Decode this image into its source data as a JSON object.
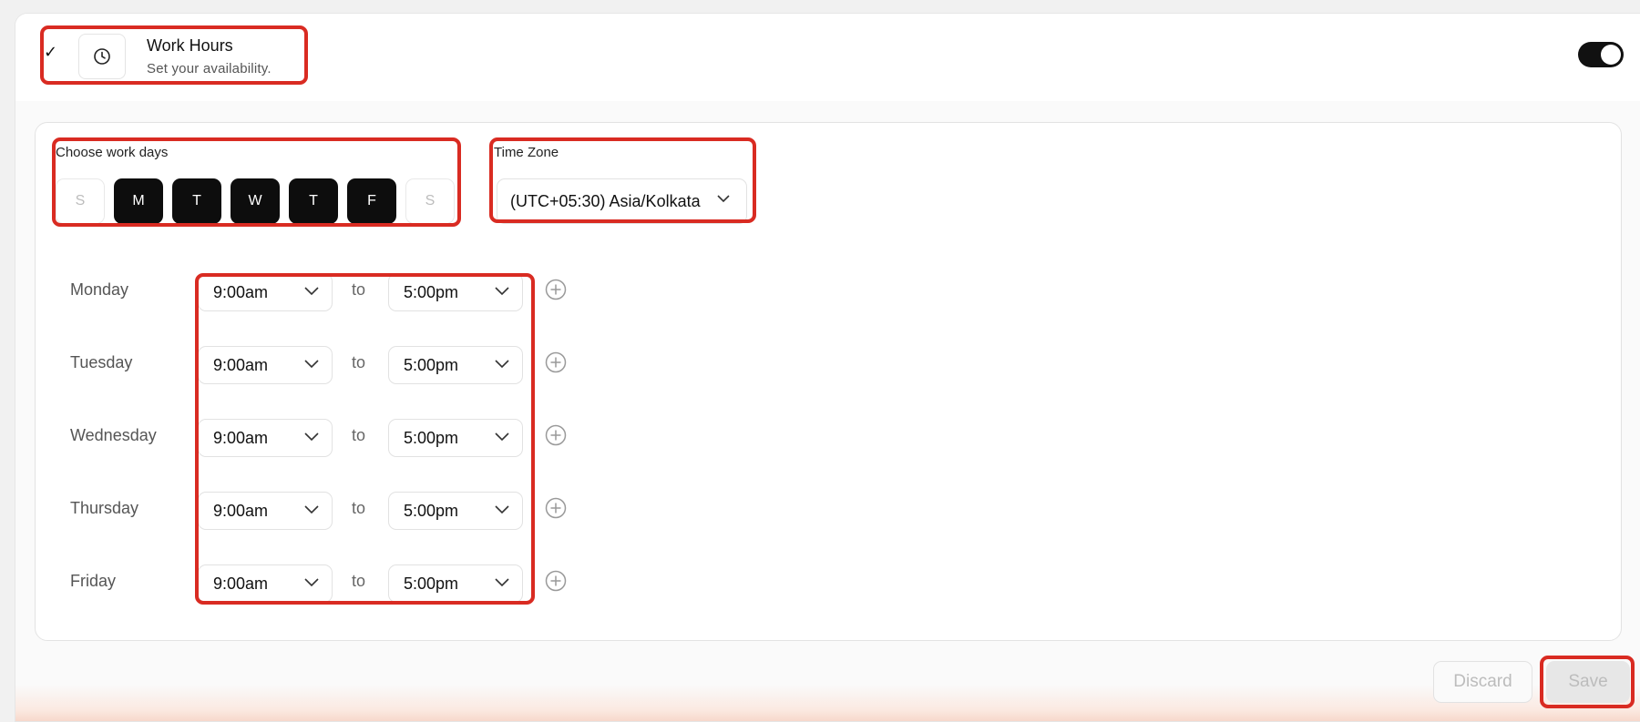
{
  "header": {
    "check_glyph": "✓",
    "title": "Work Hours",
    "subtitle": "Set your availability.",
    "enabled": true,
    "icon": "clock-icon"
  },
  "workdays": {
    "label": "Choose work days",
    "days": [
      {
        "letter": "S",
        "selected": false
      },
      {
        "letter": "M",
        "selected": true
      },
      {
        "letter": "T",
        "selected": true
      },
      {
        "letter": "W",
        "selected": true
      },
      {
        "letter": "T",
        "selected": true
      },
      {
        "letter": "F",
        "selected": true
      },
      {
        "letter": "S",
        "selected": false
      }
    ]
  },
  "timezone": {
    "label": "Time Zone",
    "value": "(UTC+05:30) Asia/Kolkata"
  },
  "schedule": {
    "to_label": "to",
    "rows": [
      {
        "day": "Monday",
        "start": "9:00am",
        "end": "5:00pm"
      },
      {
        "day": "Tuesday",
        "start": "9:00am",
        "end": "5:00pm"
      },
      {
        "day": "Wednesday",
        "start": "9:00am",
        "end": "5:00pm"
      },
      {
        "day": "Thursday",
        "start": "9:00am",
        "end": "5:00pm"
      },
      {
        "day": "Friday",
        "start": "9:00am",
        "end": "5:00pm"
      }
    ]
  },
  "actions": {
    "discard_label": "Discard",
    "save_label": "Save"
  },
  "colors": {
    "accent": "#0d0d0d",
    "highlight": "#d92b22"
  }
}
